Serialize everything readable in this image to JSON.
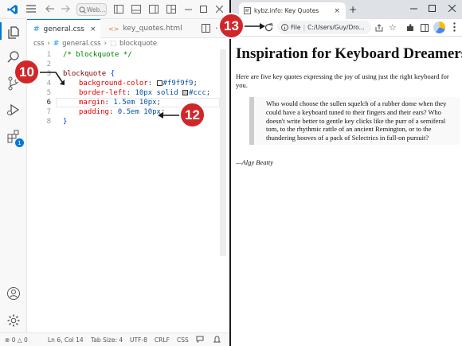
{
  "vscode": {
    "title_search": "Web...",
    "tabs": [
      {
        "label": "general.css",
        "icon": "#",
        "active": true
      },
      {
        "label": "key_quotes.html",
        "icon": "<>",
        "active": false
      }
    ],
    "breadcrumb": [
      "css",
      "general.css",
      "blockquote"
    ],
    "code_lines": [
      {
        "num": "1",
        "text": "/* blockquote */"
      },
      {
        "num": "2",
        "text": ""
      },
      {
        "num": "3",
        "selector": "blockquote",
        "brace": " {"
      },
      {
        "num": "4",
        "prop": "background-color",
        "value": "#f9f9f9",
        "swatch": "#f9f9f9"
      },
      {
        "num": "5",
        "prop": "border-left",
        "value_prefix": "10px solid ",
        "value": "#ccc",
        "swatch": "#cccccc"
      },
      {
        "num": "6",
        "prop": "margin",
        "value": "1.5em 10px"
      },
      {
        "num": "7",
        "prop": "padding",
        "value": "0.5em 10px"
      },
      {
        "num": "8",
        "text": "}"
      }
    ],
    "activity_badge": "1",
    "status": {
      "errors": "0",
      "warnings": "0",
      "position": "Ln 6, Col 14",
      "tab_size": "Tab Size: 4",
      "encoding": "UTF-8",
      "eol": "CRLF",
      "language": "CSS"
    }
  },
  "browser": {
    "tab_title": "kybz.info: Key Quotes",
    "new_tab": "+",
    "address_label": "File",
    "address": "C:/Users/Guy/Dro...",
    "page": {
      "heading": "Inspiration for Keyboard Dreamers",
      "intro": "Here are five key quotes expressing the joy of using just the right keyboard for you.",
      "quote": "Who would choose the sullen squelch of a rubber dome when they could have a keyboard tuned to their fingers and their ears? Who doesn't write better to gentle key clicks like the purr of a semiferal tom, to the rhythmic rattle of an ancient Remington, or to the thundering hooves of a pack of Selectrics in full-on pursuit?",
      "attribution": "—Algy Beatty"
    }
  },
  "callouts": [
    "10",
    "12",
    "13"
  ],
  "colors": {
    "callout": "#d1272a",
    "comment": "#008000",
    "selector": "#800000",
    "property": "#e50000",
    "value": "#0451a5",
    "brace": "#0431fa",
    "vscode_blue": "#0078d4"
  }
}
